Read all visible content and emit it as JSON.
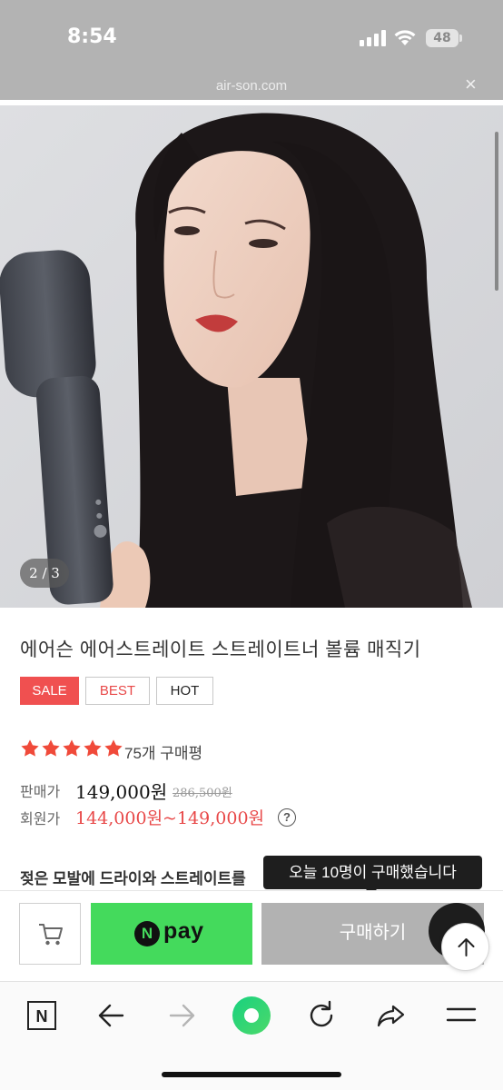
{
  "status_bar": {
    "time": "8:54",
    "battery": "48"
  },
  "browser": {
    "url": "air-son.com",
    "close_glyph": "×"
  },
  "hero": {
    "page_indicator": "2 / 3"
  },
  "product": {
    "title": "에어슨 에어스트레이트 스트레이트너 볼륨 매직기",
    "tags": [
      "SALE",
      "BEST",
      "HOT"
    ],
    "rating_stars": 5,
    "review_count": "75개 구매평",
    "price_label": "판매가",
    "price": "149,000원",
    "original_price": "286,500원",
    "member_label": "회원가",
    "member_price": "144,000원~149,000원",
    "help_glyph": "?",
    "description": "젖은 모발에 드라이와 스트레이트를"
  },
  "tooltip": {
    "text": "오늘 10명이 구매했습니다"
  },
  "buy_bar": {
    "npay_n": "N",
    "npay_label": "pay",
    "purchase_label": "구매하기"
  },
  "toolbar": {
    "n_label": "N"
  },
  "colors": {
    "accent_red": "#e84848",
    "sale_bg": "#f05050",
    "npay_green": "#44da5c",
    "star_color": "#f04a3a",
    "purchase_gray": "#b2b2b2"
  }
}
